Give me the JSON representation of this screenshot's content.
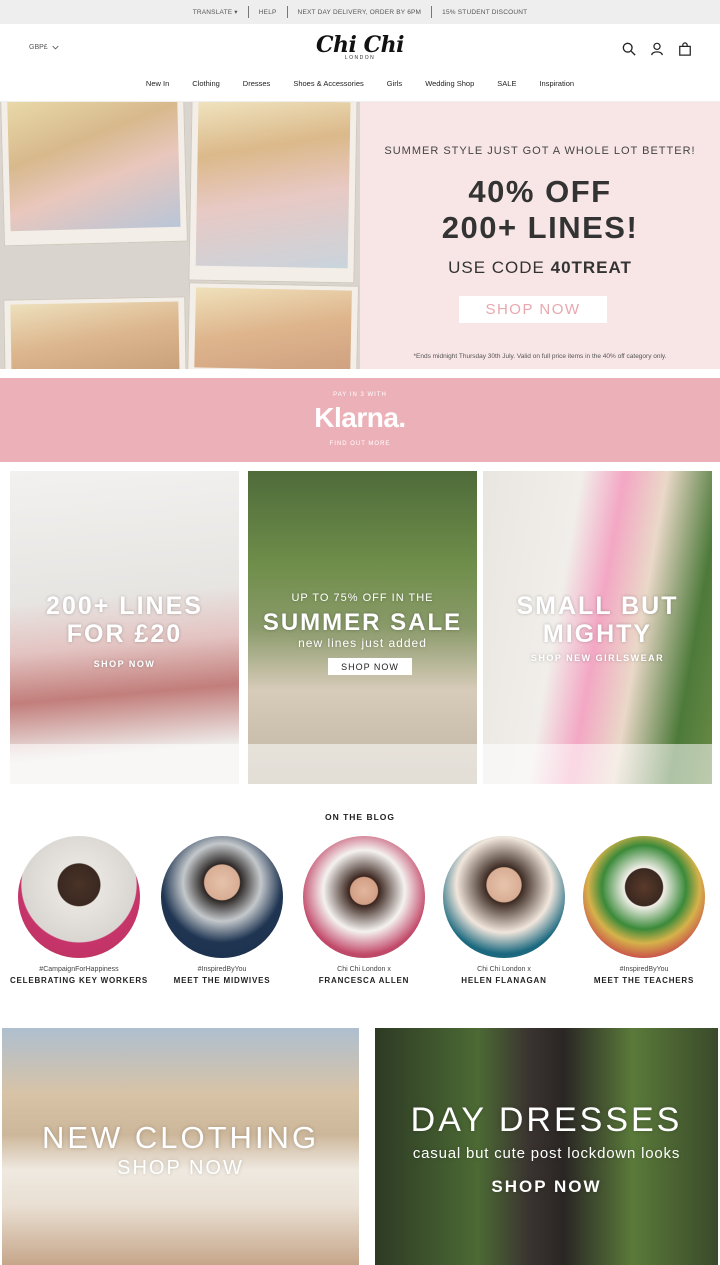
{
  "topbar": {
    "translate": "TRANSLATE ▾",
    "help": "HELP",
    "delivery": "NEXT DAY DELIVERY, ORDER BY 6PM",
    "student": "15% STUDENT DISCOUNT"
  },
  "header": {
    "currency": "GBP£",
    "logo": "Chi Chi",
    "logo_sub": "LONDON",
    "nav": [
      "New In",
      "Clothing",
      "Dresses",
      "Shoes & Accessories",
      "Girls",
      "Wedding Shop",
      "SALE",
      "Inspiration"
    ]
  },
  "hero": {
    "line1": "SUMMER STYLE JUST GOT A WHOLE LOT BETTER!",
    "line2a": "40% OFF",
    "line2b": "200+ LINES!",
    "code_prefix": "USE CODE ",
    "code": "40TREAT",
    "button": "SHOP NOW",
    "note": "*Ends midnight Thursday 30th July. Valid on full price items in the 40% off category only."
  },
  "klarna": {
    "pay": "PAY IN 3 WITH",
    "brand": "Klarna.",
    "find": "FIND OUT MORE"
  },
  "tiles": [
    {
      "title1": "200+ LINES",
      "title2": "FOR £20",
      "cta": "SHOP NOW"
    },
    {
      "pre": "UP TO 75% OFF IN THE",
      "title": "SUMMER SALE",
      "sub": "new lines just added",
      "cta": "SHOP NOW"
    },
    {
      "title1": "SMALL BUT",
      "title2": "MIGHTY",
      "cta": "SHOP NEW GIRLSWEAR"
    }
  ],
  "blog": {
    "title": "ON THE BLOG",
    "items": [
      {
        "tag": "#CampaignForHappiness",
        "title": "CELEBRATING KEY WORKERS"
      },
      {
        "tag": "#InspiredByYou",
        "title": "MEET THE MIDWIVES"
      },
      {
        "tag": "Chi Chi London x",
        "title": "FRANCESCA ALLEN"
      },
      {
        "tag": "Chi Chi London x",
        "title": "HELEN FLANAGAN"
      },
      {
        "tag": "#InspiredByYou",
        "title": "MEET THE TEACHERS"
      }
    ]
  },
  "banners": [
    {
      "title": "NEW CLOTHING",
      "cta": "SHOP NOW"
    },
    {
      "title": "DAY DRESSES",
      "sub": "casual but cute post lockdown looks",
      "cta": "SHOP NOW"
    }
  ],
  "colors": {
    "topbar_bg": "#eeeeee",
    "hero_bg": "#f8e6e6",
    "klarna_bg": "#ecb1b8",
    "hero_button_text": "#e8a8ae"
  },
  "icons": [
    "chevron-down-icon",
    "search-icon",
    "account-icon",
    "bag-icon"
  ]
}
